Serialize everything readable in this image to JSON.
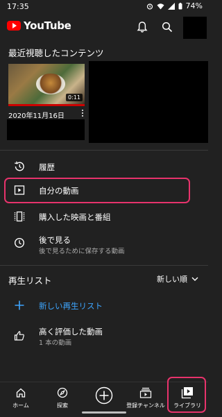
{
  "status_bar": {
    "time": "17:35",
    "battery": "74%"
  },
  "app": {
    "title": "YouTube"
  },
  "recent": {
    "heading": "最近視聴したコンテンツ",
    "video": {
      "duration": "0:11",
      "date": "2020年11月16日"
    }
  },
  "menu": {
    "history": "履歴",
    "my_videos": "自分の動画",
    "purchased": "購入した映画と番組",
    "watch_later": {
      "label": "後で見る",
      "sub": "後で見るために保存する動画"
    }
  },
  "playlists": {
    "heading": "再生リスト",
    "sort": "新しい順",
    "new_playlist": "新しい再生リスト",
    "liked": {
      "label": "高く評価した動画",
      "sub": "1 本の動画"
    }
  },
  "bottom_nav": {
    "home": "ホーム",
    "explore": "探索",
    "subscriptions": "登録チャンネル",
    "library": "ライブラリ"
  },
  "colors": {
    "accent_blue": "#3ea6ff",
    "highlight": "#e8336c",
    "brand_red": "#ff0000"
  }
}
